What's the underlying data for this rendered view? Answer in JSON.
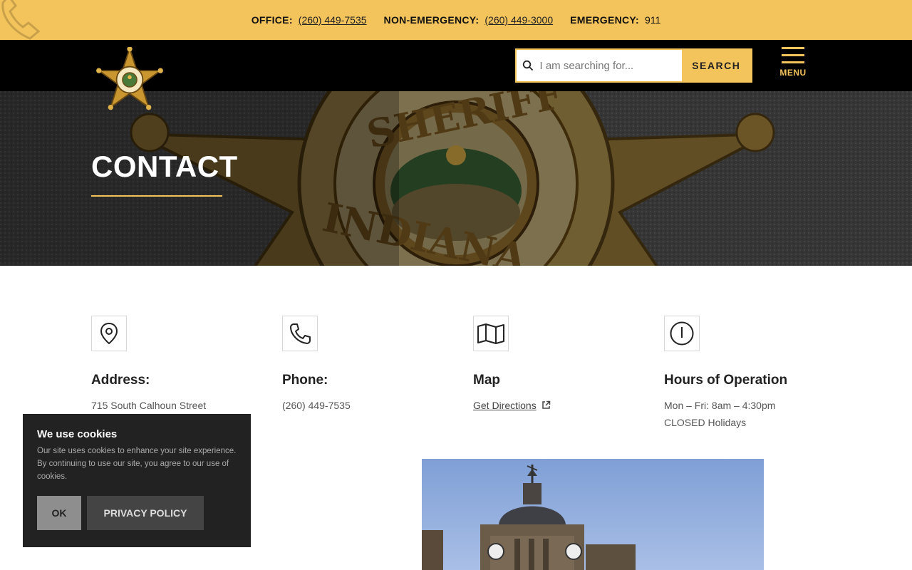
{
  "topbar": {
    "office_label": "OFFICE:",
    "office_number": "(260) 449-7535",
    "nonemergency_label": "NON-EMERGENCY:",
    "nonemergency_number": "(260) 449-3000",
    "emergency_label": "EMERGENCY:",
    "emergency_number": "911"
  },
  "header": {
    "search_placeholder": "I am searching for...",
    "search_button": "SEARCH",
    "menu_label": "MENU"
  },
  "hero": {
    "title": "CONTACT"
  },
  "info": [
    {
      "icon": "location-pin-icon",
      "heading": "Address:",
      "lines": [
        "715 South Calhoun Street"
      ]
    },
    {
      "icon": "phone-icon",
      "heading": "Phone:",
      "lines": [
        "(260) 449-7535"
      ]
    },
    {
      "icon": "map-icon",
      "heading": "Map",
      "link": "Get Directions"
    },
    {
      "icon": "clock-icon",
      "heading": "Hours of Operation",
      "lines": [
        "Mon – Fri: 8am – 4:30pm",
        "CLOSED Holidays"
      ]
    }
  ],
  "cookie": {
    "title": "We use cookies",
    "text": "Our site uses cookies to enhance your site experience. By continuing to use our site, you agree to our use of cookies.",
    "ok": "OK",
    "privacy": "PRIVACY POLICY"
  },
  "colors": {
    "accent": "#f4c45c",
    "header_bg": "#000000",
    "cookie_bg": "#222222"
  }
}
